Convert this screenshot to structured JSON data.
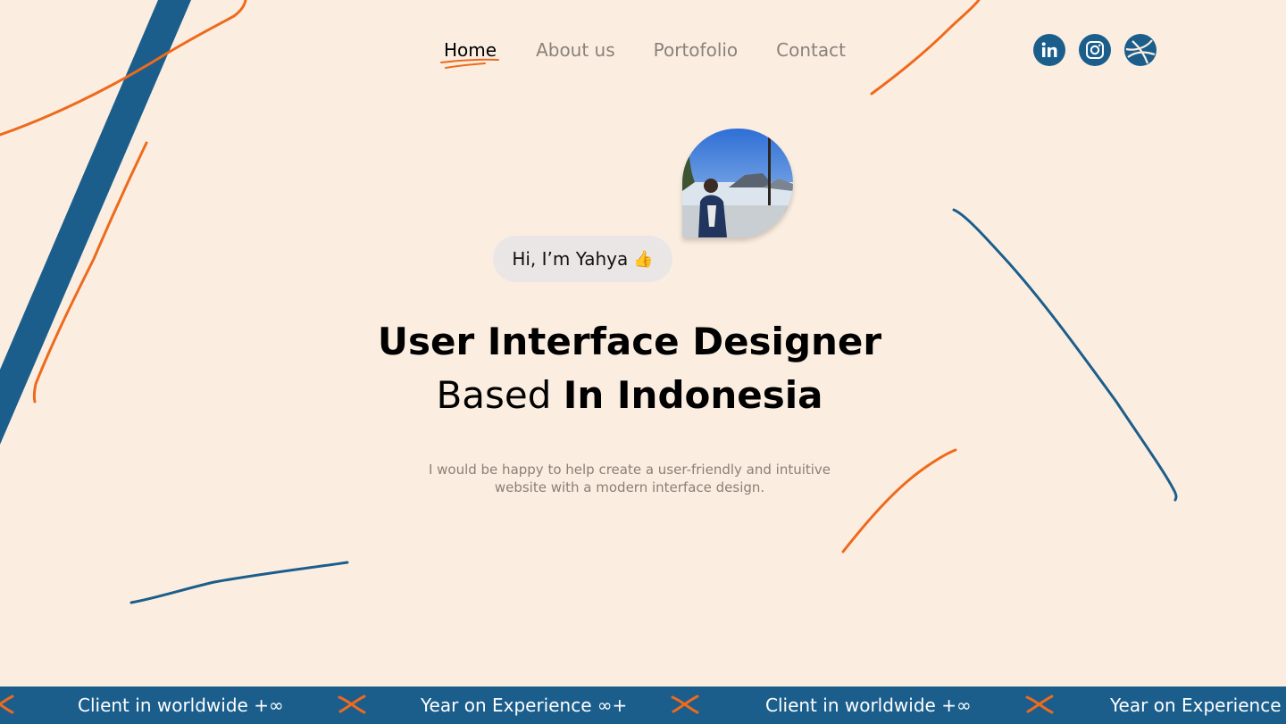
{
  "nav": {
    "items": [
      {
        "label": "Home",
        "active": true
      },
      {
        "label": "About us",
        "active": false
      },
      {
        "label": "Portofolio",
        "active": false
      },
      {
        "label": "Contact",
        "active": false
      }
    ]
  },
  "social": [
    {
      "icon": "linkedin-icon"
    },
    {
      "icon": "instagram-icon"
    },
    {
      "icon": "dribbble-icon"
    }
  ],
  "hero": {
    "greeting": "Hi, I’m Yahya",
    "greeting_emoji": "👍",
    "title_line1": "User Interface Designer",
    "title_line2_light": "Based",
    "title_line2_bold": "In Indonesia",
    "description": "I would be happy to help create a user-friendly and intuitive website with a modern interface design."
  },
  "ticker": {
    "items": [
      "Client in worldwide +∞",
      "Year on Experience ∞+",
      "Client in worldwide +∞",
      "Year on Experience ∞+"
    ]
  },
  "colors": {
    "background": "#FBEEE1",
    "brand_blue": "#1B5E8C",
    "accent_orange": "#EE6A1C"
  }
}
